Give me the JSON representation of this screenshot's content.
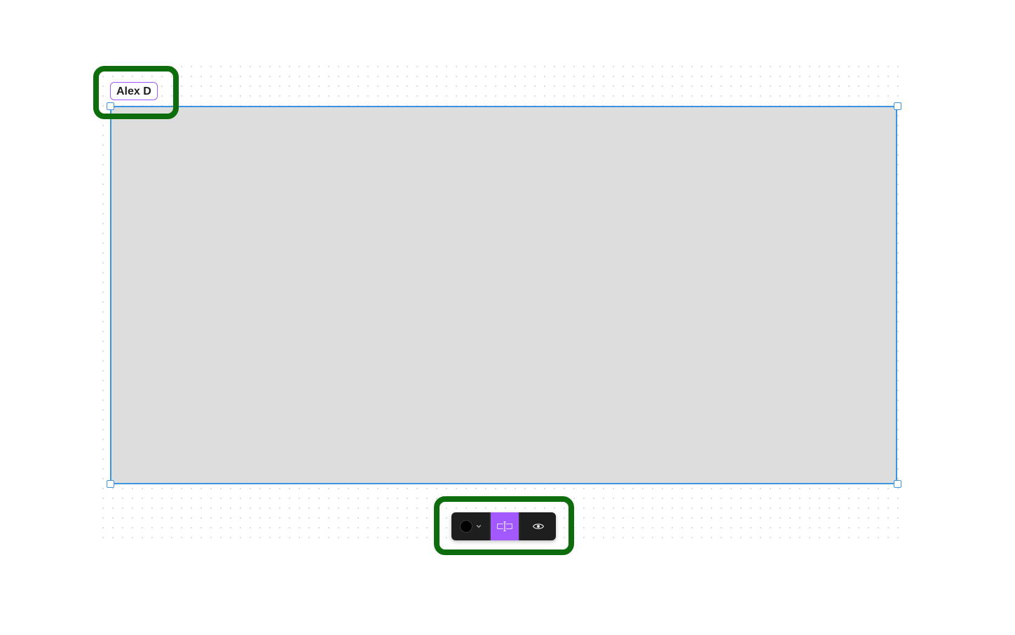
{
  "frame": {
    "label": "Alex D",
    "fill_color": "#dddddd",
    "selection_color": "#3d95e0",
    "label_accent_color": "#a259ff"
  },
  "toolbar": {
    "color_picker": {
      "icon": "color-swatch-icon",
      "value_color": "#000000",
      "dropdown_icon": "chevron-down-icon"
    },
    "resize_button": {
      "icon": "resize-to-fit-icon",
      "active": true,
      "active_color": "#a259ff"
    },
    "visibility_button": {
      "icon": "eye-icon"
    }
  },
  "annotations": {
    "highlight_color": "#0d6d0d"
  }
}
